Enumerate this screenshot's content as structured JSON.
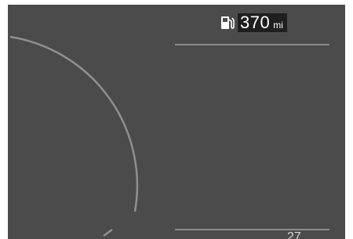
{
  "cluster": {
    "range": {
      "value": "370",
      "unit": "mi",
      "icon": "fuel-pump-icon"
    },
    "bottom_readout": "27"
  },
  "colors": {
    "background": "#4b4b4b",
    "gauge_arc": "#8f8f8f",
    "divider": "#8c8c8c",
    "readout_box": "#1f1f1f",
    "text": "#ffffff"
  }
}
